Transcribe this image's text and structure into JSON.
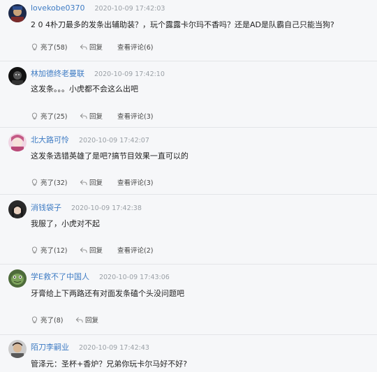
{
  "comments": [
    {
      "user": "lovekobe0370",
      "time": "2020-10-09 17:42:03",
      "text": "2 0 4朴刀最多的发条出辅助装？，玩个露露卡尔玛不香吗？还是AD是队霸自己只能当狗?",
      "like": "亮了(58)",
      "reply": "回复",
      "view": "查看评论(6)"
    },
    {
      "user": "林加德终老曼联",
      "time": "2020-10-09 17:42:10",
      "text": "这发条。。。小虎都不会这么出吧",
      "like": "亮了(25)",
      "reply": "回复",
      "view": "查看评论(3)"
    },
    {
      "user": "北大路可怜",
      "time": "2020-10-09 17:42:07",
      "text": "这发条选错英雄了是吧?搞节目效果一直可以的",
      "like": "亮了(32)",
      "reply": "回复",
      "view": "查看评论(3)"
    },
    {
      "user": "消钱袋子",
      "time": "2020-10-09 17:42:38",
      "text": "我服了，小虎对不起",
      "like": "亮了(12)",
      "reply": "回复",
      "view": "查看评论(2)"
    },
    {
      "user": "学E救不了中国人",
      "time": "2020-10-09 17:43:06",
      "text": "牙膏给上下两路还有对面发条磕个头没问题吧",
      "like": "亮了(8)",
      "reply": "回复",
      "view": ""
    },
    {
      "user": "陌刀李嗣业",
      "time": "2020-10-09 17:42:43",
      "text": "管泽元：圣杯+香炉？兄弟你玩卡尔马好不好?",
      "like": "",
      "reply": "",
      "view": ""
    }
  ],
  "colors": {
    "username": "#3f7cc4",
    "time": "#9aa0a6",
    "background": "#f6f7f9"
  },
  "icons": {
    "like": "bulb-icon",
    "reply": "reply-arrow-icon"
  }
}
